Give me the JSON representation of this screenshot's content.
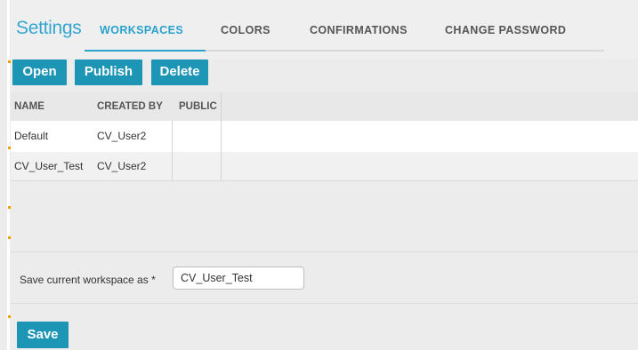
{
  "header": {
    "title": "Settings",
    "tabs": [
      {
        "label": "WORKSPACES",
        "active": true
      },
      {
        "label": "COLORS",
        "active": false
      },
      {
        "label": "CONFIRMATIONS",
        "active": false
      },
      {
        "label": "CHANGE PASSWORD",
        "active": false
      }
    ]
  },
  "toolbar": {
    "open_label": "Open",
    "publish_label": "Publish",
    "delete_label": "Delete"
  },
  "table": {
    "columns": [
      "NAME",
      "CREATED BY",
      "PUBLIC"
    ],
    "rows": [
      [
        "Default",
        "CV_User2",
        ""
      ],
      [
        "CV_User_Test",
        "CV_User2",
        ""
      ]
    ]
  },
  "save": {
    "label": "Save current workspace as *",
    "value": "CV_User_Test",
    "button_label": "Save"
  },
  "colors": {
    "accent": "#2aa2cd",
    "button": "#1d95b5"
  }
}
